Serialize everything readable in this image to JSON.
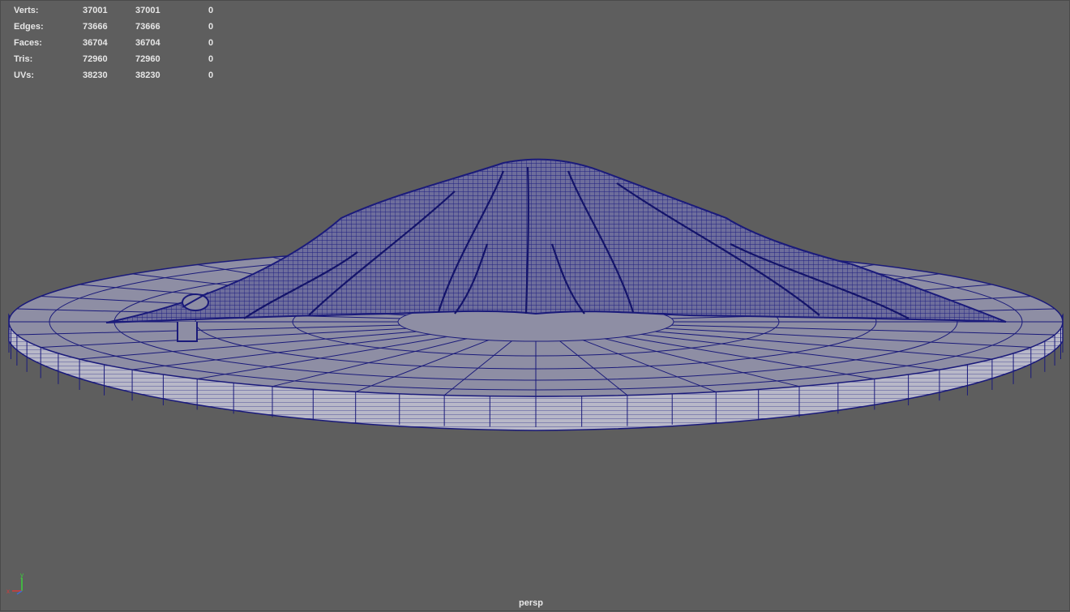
{
  "heads_up_display": {
    "rows": [
      {
        "label": "Verts:",
        "world": "37001",
        "selection": "37001",
        "highlighted": "0"
      },
      {
        "label": "Edges:",
        "world": "73666",
        "selection": "73666",
        "highlighted": "0"
      },
      {
        "label": "Faces:",
        "world": "36704",
        "selection": "36704",
        "highlighted": "0"
      },
      {
        "label": "Tris:",
        "world": "72960",
        "selection": "72960",
        "highlighted": "0"
      },
      {
        "label": "UVs:",
        "world": "38230",
        "selection": "38230",
        "highlighted": "0"
      }
    ]
  },
  "viewport": {
    "camera_name": "persp",
    "background_color": "#5e5e5e",
    "wireframe_color": "#1a1a7a"
  },
  "axis_gizmo": {
    "y_label": "y",
    "x_label": "x",
    "y_color": "#3cd23c",
    "x_color": "#d23c3c",
    "z_color": "#3c6cd2"
  }
}
